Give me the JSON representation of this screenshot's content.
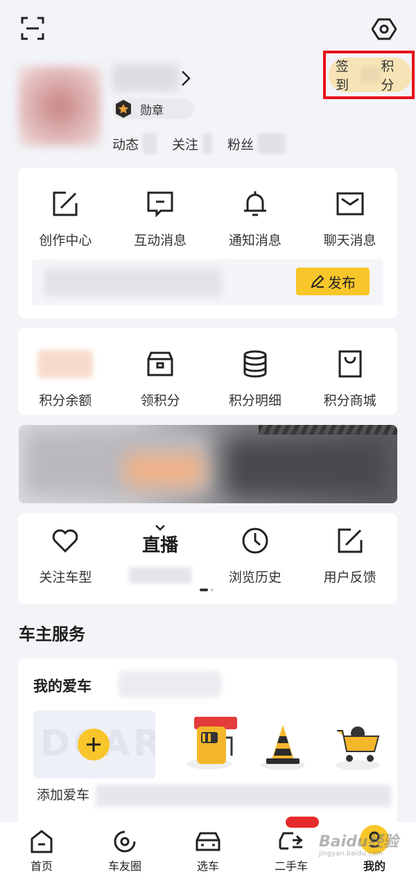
{
  "header": {
    "scan_icon": "scan-icon",
    "settings_icon": "settings-hexagon-icon"
  },
  "profile": {
    "medal_label": "勋章",
    "stats": [
      {
        "label": "动态"
      },
      {
        "label": "关注"
      },
      {
        "label": "粉丝"
      }
    ],
    "checkin": {
      "left": "签到",
      "right": "积分"
    }
  },
  "messages": {
    "items": [
      {
        "label": "创作中心",
        "icon": "edit-square-icon"
      },
      {
        "label": "互动消息",
        "icon": "comment-icon"
      },
      {
        "label": "通知消息",
        "icon": "bell-icon"
      },
      {
        "label": "聊天消息",
        "icon": "envelope-icon"
      }
    ],
    "publish_label": "发布"
  },
  "points": {
    "items": [
      {
        "label": "积分余额",
        "icon": "blurred-value"
      },
      {
        "label": "领积分",
        "icon": "box-icon"
      },
      {
        "label": "积分明细",
        "icon": "database-icon"
      },
      {
        "label": "积分商城",
        "icon": "shopping-bag-icon"
      }
    ]
  },
  "tools": {
    "items": [
      {
        "label": "关注车型",
        "icon": "heart-icon"
      },
      {
        "label": "",
        "icon": "live-tv-icon",
        "icon_text": "直播"
      },
      {
        "label": "浏览历史",
        "icon": "clock-icon"
      },
      {
        "label": "用户反馈",
        "icon": "edit-square-icon"
      }
    ]
  },
  "services": {
    "section_title": "车主服务",
    "mycar_title": "我的爱车",
    "addcar_watermark": "DCAR",
    "addcar_label": "添加爱车"
  },
  "tabbar": {
    "items": [
      {
        "label": "首页",
        "icon": "home-icon"
      },
      {
        "label": "车友圈",
        "icon": "circle-target-icon"
      },
      {
        "label": "选车",
        "icon": "car-front-icon"
      },
      {
        "label": "二手车",
        "icon": "car-swap-icon"
      },
      {
        "label": "我的",
        "icon": "profile-logo-icon"
      }
    ],
    "active": "我的",
    "accent": "#f8c62a"
  },
  "watermark": {
    "text": "Baidu经验",
    "sub": "jingyan.baidu.com"
  },
  "colors": {
    "accent": "#f8c62a",
    "highlight_border": "#e8101a",
    "background": "#f3f4f8"
  }
}
